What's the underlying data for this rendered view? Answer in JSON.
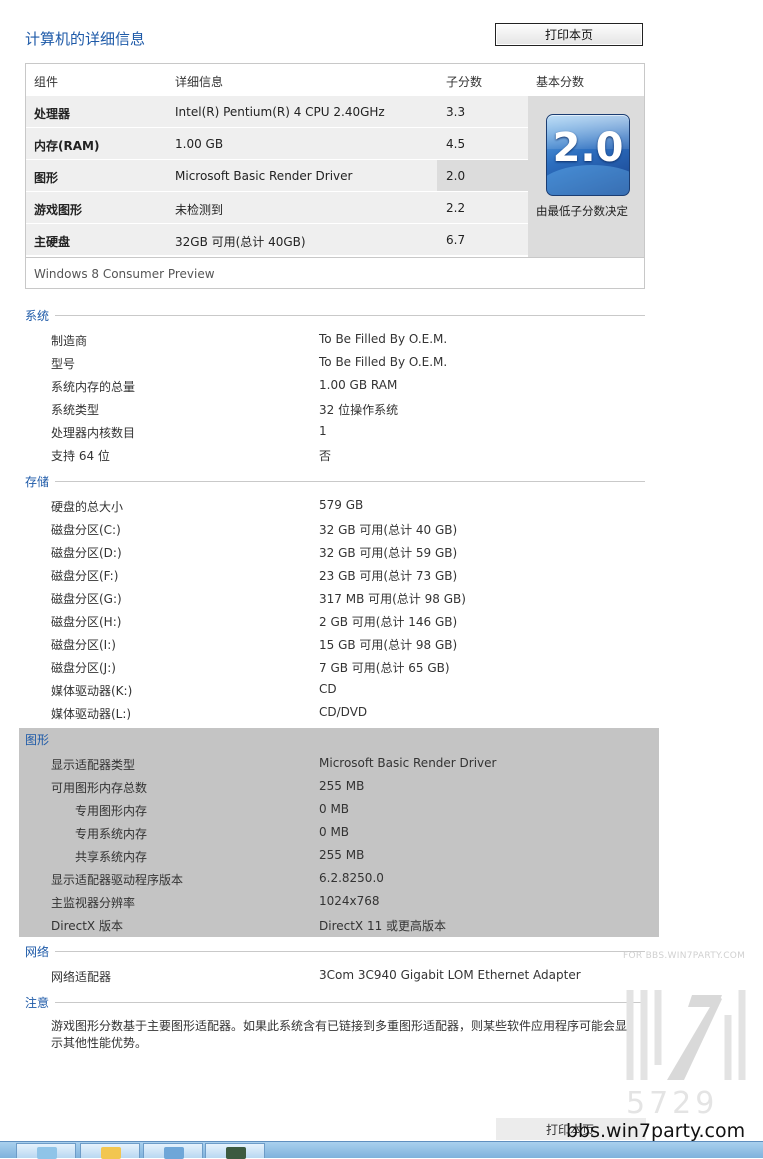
{
  "header": {
    "title": "计算机的详细信息",
    "print_label": "打印本页"
  },
  "score_table": {
    "headers": {
      "component": "组件",
      "details": "详细信息",
      "subscore": "子分数",
      "base": "基本分数"
    },
    "rows": [
      {
        "name": "处理器",
        "detail": "Intel(R) Pentium(R) 4 CPU 2.40GHz",
        "score": "3.3"
      },
      {
        "name": "内存(RAM)",
        "detail": "1.00 GB",
        "score": "4.5"
      },
      {
        "name": "图形",
        "detail": "Microsoft Basic Render Driver",
        "score": "2.0"
      },
      {
        "name": "游戏图形",
        "detail": "未检测到",
        "score": "2.2"
      },
      {
        "name": "主硬盘",
        "detail": "32GB 可用(总计 40GB)",
        "score": "6.7"
      }
    ],
    "base_score": "2.0",
    "base_caption": "由最低子分数决定",
    "os_name": "Windows 8 Consumer Preview"
  },
  "sections": {
    "system": {
      "title": "系统",
      "items": [
        {
          "k": "制造商",
          "v": "To Be Filled By O.E.M."
        },
        {
          "k": "型号",
          "v": "To Be Filled By O.E.M."
        },
        {
          "k": "系统内存的总量",
          "v": "1.00 GB RAM"
        },
        {
          "k": "系统类型",
          "v": "32 位操作系统"
        },
        {
          "k": "处理器内核数目",
          "v": "1"
        },
        {
          "k": "支持 64 位",
          "v": "否"
        }
      ]
    },
    "storage": {
      "title": "存储",
      "items": [
        {
          "k": "硬盘的总大小",
          "v": "579 GB"
        },
        {
          "k": "磁盘分区(C:)",
          "v": "32 GB 可用(总计 40 GB)"
        },
        {
          "k": "磁盘分区(D:)",
          "v": "32 GB 可用(总计 59 GB)"
        },
        {
          "k": "磁盘分区(F:)",
          "v": "23 GB 可用(总计 73 GB)"
        },
        {
          "k": "磁盘分区(G:)",
          "v": "317 MB 可用(总计 98 GB)"
        },
        {
          "k": "磁盘分区(H:)",
          "v": "2 GB 可用(总计 146 GB)"
        },
        {
          "k": "磁盘分区(I:)",
          "v": "15 GB 可用(总计 98 GB)"
        },
        {
          "k": "磁盘分区(J:)",
          "v": "7 GB 可用(总计 65 GB)"
        },
        {
          "k": "媒体驱动器(K:)",
          "v": "CD"
        },
        {
          "k": "媒体驱动器(L:)",
          "v": "CD/DVD"
        }
      ]
    },
    "graphics": {
      "title": "图形",
      "items": [
        {
          "k": "显示适配器类型",
          "v": "Microsoft Basic Render Driver"
        },
        {
          "k": "可用图形内存总数",
          "v": "255 MB"
        },
        {
          "k": "专用图形内存",
          "v": "0 MB"
        },
        {
          "k": "专用系统内存",
          "v": "0 MB"
        },
        {
          "k": "共享系统内存",
          "v": "255 MB"
        },
        {
          "k": "显示适配器驱动程序版本",
          "v": "6.2.8250.0"
        },
        {
          "k": "主监视器分辨率",
          "v": "1024x768"
        },
        {
          "k": "DirectX 版本",
          "v": "DirectX 11 或更高版本"
        }
      ]
    },
    "network": {
      "title": "网络",
      "items": [
        {
          "k": "网络适配器",
          "v": "3Com 3C940 Gigabit LOM Ethernet Adapter"
        }
      ]
    },
    "notes": {
      "title": "注意",
      "text": "游戏图形分数基于主要图形适配器。如果此系统含有已链接到多重图形适配器，则某些软件应用程序可能会显示其他性能优势。"
    }
  },
  "watermark": {
    "small": "FOR BBS.WIN7PARTY.COM",
    "digits": "5729",
    "url": "bbs.win7party.com"
  },
  "footer": {
    "print_label": "打印本页"
  }
}
